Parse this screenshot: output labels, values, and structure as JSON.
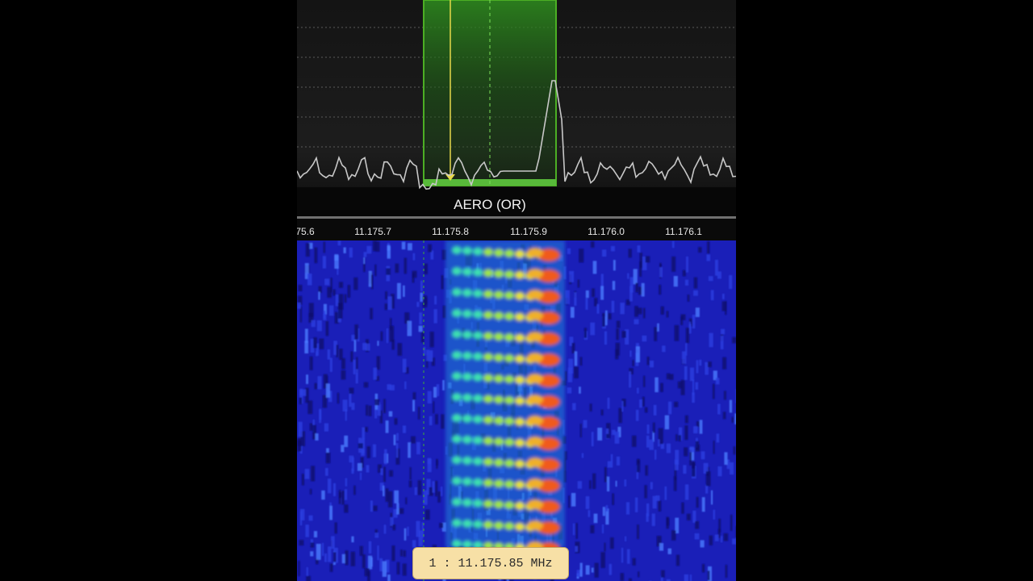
{
  "spectrum": {
    "demod_mode_label": "AERO (OR)"
  },
  "axis": {
    "ticks": [
      {
        "label": "75.6",
        "id": "tick-0"
      },
      {
        "label": "11.175.7",
        "id": "tick-1"
      },
      {
        "label": "11.175.8",
        "id": "tick-2"
      },
      {
        "label": "11.175.9",
        "id": "tick-3"
      },
      {
        "label": "11.176.0",
        "id": "tick-4"
      },
      {
        "label": "11.176.1",
        "id": "tick-5"
      }
    ]
  },
  "tooltip": {
    "vfo_index": "1",
    "separator": ":",
    "frequency": "11.175.85",
    "unit": "MHz"
  },
  "colors": {
    "passband": "#4caf24",
    "tuning_line": "#e8d94a",
    "trace": "#bdbdbd",
    "waterfall_bg": "#1a1fb8"
  }
}
